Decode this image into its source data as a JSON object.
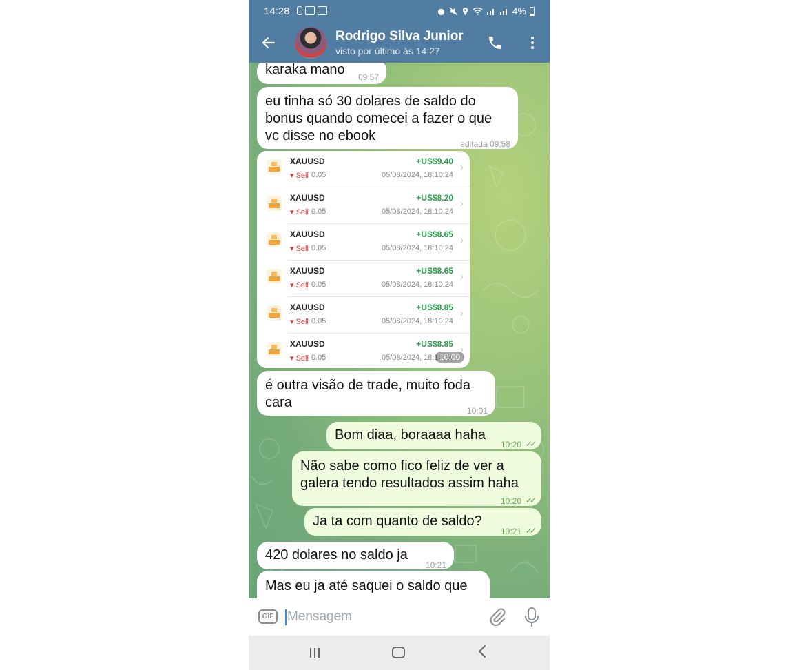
{
  "status_bar": {
    "time": "14:28",
    "battery": "4%"
  },
  "header": {
    "contact_name": "Rodrigo Silva Junior",
    "last_seen": "visto por último às 14:27"
  },
  "messages": [
    {
      "type": "incoming",
      "text": "karaka mano",
      "time": "09:57"
    },
    {
      "type": "incoming",
      "lines": [
        "eu tinha só 30 dolares de saldo do",
        "bonus quando comecei a fazer o que",
        "vc disse no ebook"
      ],
      "time": "editada 09:58"
    },
    {
      "type": "incoming-photo",
      "time": "10:00"
    },
    {
      "type": "incoming",
      "lines": [
        "é outra visão de trade, muito foda",
        "cara"
      ],
      "time": "10:01"
    },
    {
      "type": "outgoing",
      "text": "Bom diaa, boraaaa haha",
      "time": "10:20"
    },
    {
      "type": "outgoing",
      "lines": [
        "Não sabe como fico feliz de ver a",
        "galera tendo resultados assim haha"
      ],
      "time": "10:20"
    },
    {
      "type": "outgoing",
      "text": "Ja ta com quanto de saldo?",
      "time": "10:21"
    },
    {
      "type": "incoming",
      "text": "420 dolares no saldo ja",
      "time": "10:21"
    },
    {
      "type": "incoming",
      "text": "Mas eu ja até saquei o saldo que"
    }
  ],
  "trades": [
    {
      "symbol": "XAUUSD",
      "side": "Sell",
      "lot": "0.05",
      "profit": "+US$9.40",
      "date": "05/08/2024, 18:10:24"
    },
    {
      "symbol": "XAUUSD",
      "side": "Sell",
      "lot": "0.05",
      "profit": "+US$8.20",
      "date": "05/08/2024, 18:10:24"
    },
    {
      "symbol": "XAUUSD",
      "side": "Sell",
      "lot": "0.05",
      "profit": "+US$8.65",
      "date": "05/08/2024, 18:10:24"
    },
    {
      "symbol": "XAUUSD",
      "side": "Sell",
      "lot": "0.05",
      "profit": "+US$8.65",
      "date": "05/08/2024, 18:10:24"
    },
    {
      "symbol": "XAUUSD",
      "side": "Sell",
      "lot": "0.05",
      "profit": "+US$8.85",
      "date": "05/08/2024, 18:10:24"
    },
    {
      "symbol": "XAUUSD",
      "side": "Sell",
      "lot": "0.05",
      "profit": "+US$8.85",
      "date": "05/08/2024, 18:10:24"
    }
  ],
  "composer": {
    "gif_label": "GIF",
    "placeholder": "Mensagem"
  },
  "icons": {
    "back": "arrow-left-icon",
    "call": "phone-icon",
    "menu": "more-vertical-icon",
    "attach": "paperclip-icon",
    "mic": "microphone-icon",
    "read": "double-check-icon"
  },
  "colors": {
    "header": "#527da3",
    "outgoing_bubble": "#effdde",
    "profit": "#26a047",
    "sell": "#e53935",
    "read_checks": "#5fae55"
  }
}
